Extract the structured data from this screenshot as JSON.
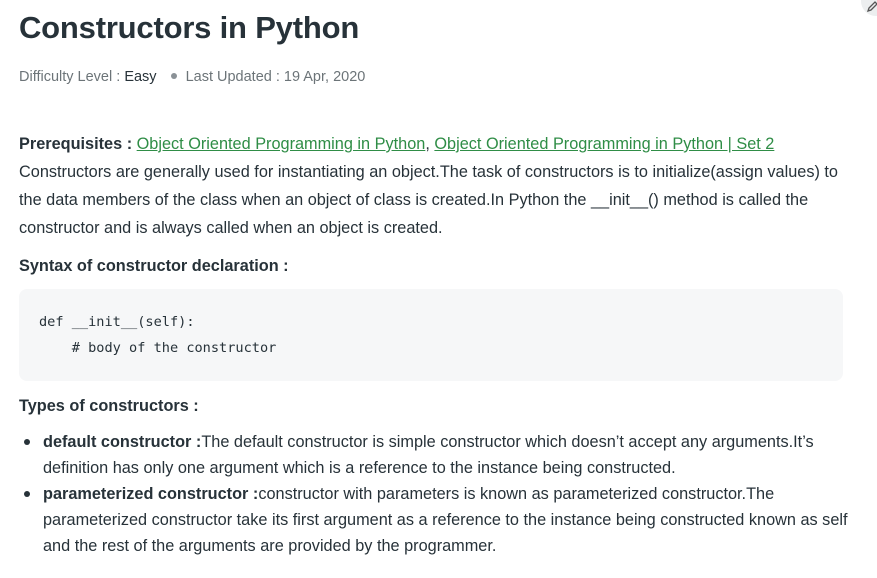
{
  "article": {
    "title": "Constructors in Python",
    "difficulty_label": "Difficulty Level : ",
    "difficulty_value": "Easy",
    "updated_label": "Last Updated : ",
    "updated_value": "19 Apr, 2020",
    "prereq_label": "Prerequisites : ",
    "prereq_links": [
      "Object Oriented Programming in Python",
      "Object Oriented Programming in Python | Set 2"
    ],
    "prereq_separator": ", ",
    "intro": "Constructors are generally used for instantiating an object.The task of constructors is to initialize(assign values) to the data members of the class when an object of class is created.In Python the __init__() method is called the constructor and is always called when an object is created.",
    "syntax_heading": "Syntax of constructor declaration :",
    "code": "def __init__(self):\n    # body of the constructor",
    "types_heading": "Types of constructors :",
    "types": [
      {
        "term": "default constructor :",
        "desc": "The default constructor is simple constructor which doesn’t accept any arguments.It’s definition has only one argument which is a reference to the instance being constructed."
      },
      {
        "term": "parameterized constructor :",
        "desc": "constructor with parameters is known as parameterized constructor.The parameterized constructor take its first argument as a reference to the instance being constructed known as self and the rest of the arguments are provided by the programmer."
      }
    ]
  },
  "colors": {
    "link": "#2f8d46",
    "text": "#273239",
    "code_bg": "#f6f7f8"
  },
  "icons": {
    "corner": "edit-icon"
  }
}
